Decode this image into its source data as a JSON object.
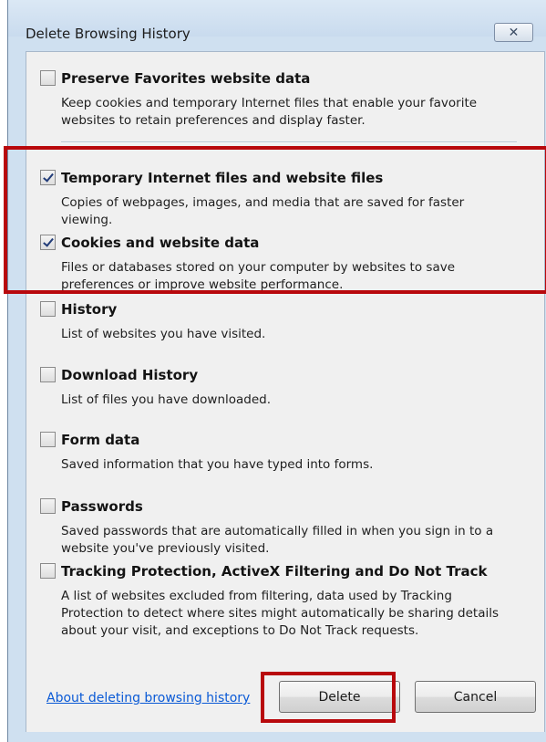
{
  "window": {
    "title": "Delete Browsing History",
    "close_glyph": "✕"
  },
  "options": [
    {
      "title": "Preserve Favorites website data",
      "description": "Keep cookies and temporary Internet files that enable your favorite websites to retain preferences and display faster.",
      "checked": false
    },
    {
      "title": "Temporary Internet files and website files",
      "description": "Copies of webpages, images, and media that are saved for faster viewing.",
      "checked": true
    },
    {
      "title": "Cookies and website data",
      "description": "Files or databases stored on your computer by websites to save preferences or improve website performance.",
      "checked": true
    },
    {
      "title": "History",
      "description": "List of websites you have visited.",
      "checked": false
    },
    {
      "title": "Download History",
      "description": "List of files you have downloaded.",
      "checked": false
    },
    {
      "title": "Form data",
      "description": "Saved information that you have typed into forms.",
      "checked": false
    },
    {
      "title": "Passwords",
      "description": "Saved passwords that are automatically filled in when you sign in to a website you've previously visited.",
      "checked": false
    },
    {
      "title": "Tracking Protection, ActiveX Filtering and Do Not Track",
      "description": "A list of websites excluded from filtering, data used by Tracking Protection to detect where sites might automatically be sharing details about your visit, and exceptions to Do Not Track requests.",
      "checked": false
    }
  ],
  "footer": {
    "about_link": "About deleting browsing history",
    "delete_label": "Delete",
    "cancel_label": "Cancel"
  },
  "colors": {
    "highlight": "#b8080c",
    "link": "#0a5ad6"
  },
  "icons": {
    "close": "close-icon",
    "checkmark": "checkmark-icon"
  }
}
